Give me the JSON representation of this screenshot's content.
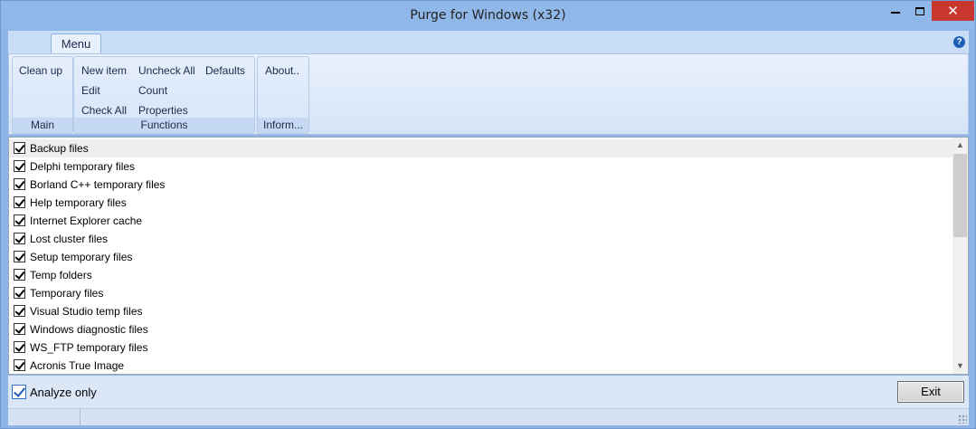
{
  "window": {
    "title": "Purge for Windows (x32)"
  },
  "ribbon": {
    "tabs": [
      "Menu"
    ],
    "groups": {
      "main": {
        "caption": "Main",
        "buttons": [
          "Clean up"
        ]
      },
      "functions": {
        "caption": "Functions",
        "buttons": [
          "New item",
          "Uncheck All",
          "Defaults",
          "Edit",
          "Count",
          "Check All",
          "Properties"
        ]
      },
      "inform": {
        "caption": "Inform...",
        "buttons": [
          "About.."
        ]
      }
    }
  },
  "list": {
    "items": [
      {
        "label": "Backup files",
        "checked": true
      },
      {
        "label": "Delphi temporary files",
        "checked": true
      },
      {
        "label": "Borland C++ temporary files",
        "checked": true
      },
      {
        "label": "Help temporary files",
        "checked": true
      },
      {
        "label": "Internet Explorer cache",
        "checked": true
      },
      {
        "label": "Lost cluster files",
        "checked": true
      },
      {
        "label": "Setup temporary files",
        "checked": true
      },
      {
        "label": "Temp folders",
        "checked": true
      },
      {
        "label": "Temporary files",
        "checked": true
      },
      {
        "label": "Visual Studio temp files",
        "checked": true
      },
      {
        "label": "Windows diagnostic files",
        "checked": true
      },
      {
        "label": "WS_FTP temporary files",
        "checked": true
      },
      {
        "label": "Acronis True Image",
        "checked": true
      }
    ]
  },
  "bottom": {
    "analyze_label": "Analyze only",
    "analyze_checked": true,
    "exit_label": "Exit"
  }
}
